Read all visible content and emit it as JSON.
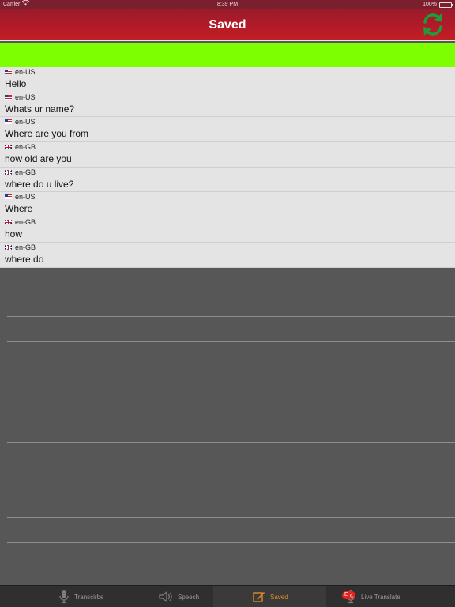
{
  "status_bar": {
    "carrier": "Carrier",
    "time": "8:39 PM",
    "battery": "100%"
  },
  "nav": {
    "title": "Saved",
    "refresh_icon": "refresh-icon",
    "accent_color": "#c21e25",
    "refresh_color": "#1f9c3a"
  },
  "banner_color": "#7dff02",
  "saved_items": [
    {
      "lang": "en-US",
      "flag": "us-flag-icon",
      "text": "Hello"
    },
    {
      "lang": "en-US",
      "flag": "us-flag-icon",
      "text": "Whats ur name?"
    },
    {
      "lang": "en-US",
      "flag": "us-flag-icon",
      "text": "Where are you from"
    },
    {
      "lang": "en-GB",
      "flag": "gb-flag-icon",
      "text": "how old are you"
    },
    {
      "lang": "en-GB",
      "flag": "gb-flag-icon",
      "text": "where do u live?"
    },
    {
      "lang": "en-US",
      "flag": "us-flag-icon",
      "text": "Where"
    },
    {
      "lang": "en-GB",
      "flag": "gb-flag-icon",
      "text": "how"
    },
    {
      "lang": "en-GB",
      "flag": "gb-flag-icon",
      "text": "where do"
    }
  ],
  "tabs": [
    {
      "label": "Transcirbe",
      "icon": "microphone-icon",
      "active": false
    },
    {
      "label": "Speech",
      "icon": "speaker-icon",
      "active": false
    },
    {
      "label": "Saved",
      "icon": "edit-icon",
      "active": true
    },
    {
      "label": "Live Translate",
      "icon": "microphone-icon",
      "badge": "E ج",
      "active": false
    }
  ],
  "active_tab_color": "#e28a2a"
}
